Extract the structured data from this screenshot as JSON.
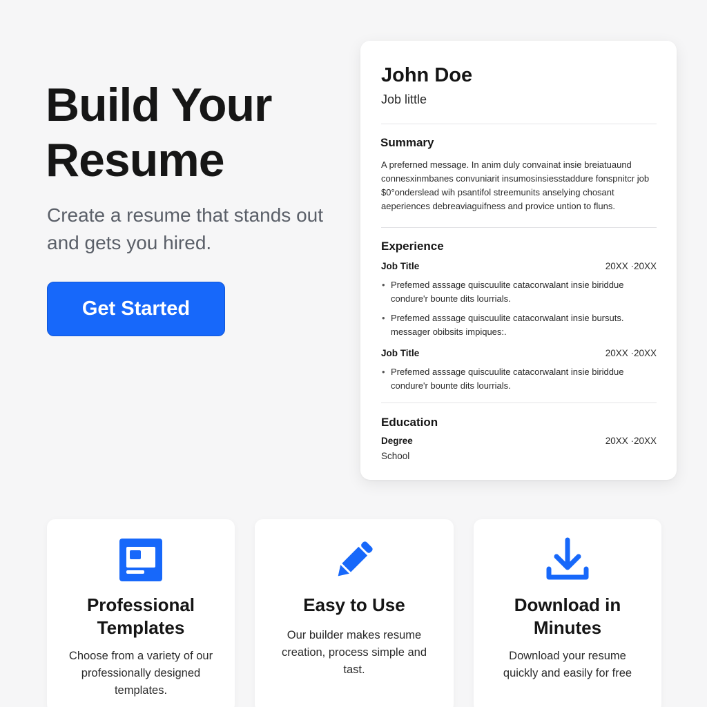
{
  "hero": {
    "title_line1": "Build Your",
    "title_line2": "Resume",
    "subtitle": "Create a resume that stands out and gets you hired.",
    "cta_label": "Get Started"
  },
  "resume": {
    "name": "John Doe",
    "job_title": "Job little",
    "summary": {
      "heading": "Summary",
      "text": "A preferned message. In anim duly convainat insie breiatuaund connesxinmbanes convuniarit insumosinsiesstaddure fonspnitcr job $0°onderslead wih psantifol streemunits anselying chosant aeperiences debreaviaguifness and provice untion to fluns."
    },
    "experience": {
      "heading": "Experience",
      "jobs": [
        {
          "title": "Job Title",
          "dates": "20XX ·20XX",
          "bullets": [
            "Prefemed asssage quiscuulite catacorwalant insie biriddue condure'r bounte dits lourrials.",
            "Prefemed asssage quiscuulite catacorwalant insie bursuts. messager obibsits impiques:."
          ]
        },
        {
          "title": "Job Title",
          "dates": "20XX ·20XX",
          "bullets": [
            "Prefemed asssage quiscuulite catacorwalant insie biriddue condure'r bounte dits lourrials."
          ]
        }
      ]
    },
    "education": {
      "heading": "Education",
      "degree": "Degree",
      "dates": "20XX ·20XX",
      "school": "School"
    }
  },
  "features": [
    {
      "icon": "template-window-icon",
      "title_line1": "Professional",
      "title_line2": "Templates",
      "description": "Choose from a variety of our professionally designed templates."
    },
    {
      "icon": "pencil-icon",
      "title_line1": "Easy to Use",
      "title_line2": "",
      "description": "Our builder makes resume creation, process simple and tast."
    },
    {
      "icon": "download-icon",
      "title_line1": "Download in",
      "title_line2": "Minutes",
      "description": "Download your resume quickly and easily for free"
    }
  ],
  "colors": {
    "accent": "#1768fa",
    "background": "#f6f6f7",
    "card": "#ffffff"
  }
}
